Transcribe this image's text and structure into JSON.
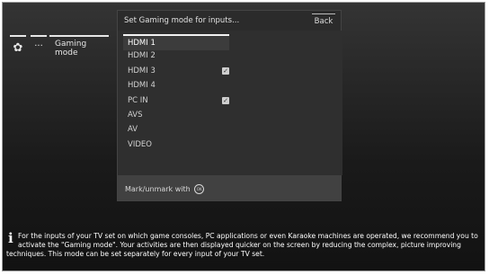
{
  "toolbar": {
    "gear_icon": "gear-icon",
    "more_label": "···",
    "gaming_label": "Gaming mode"
  },
  "panel": {
    "title": "Set Gaming mode for inputs...",
    "back_label": "Back",
    "items": [
      {
        "label": "HDMI 1",
        "checked": false,
        "selected": true
      },
      {
        "label": "HDMI 2",
        "checked": false,
        "selected": false
      },
      {
        "label": "HDMI 3",
        "checked": true,
        "selected": false
      },
      {
        "label": "HDMI 4",
        "checked": false,
        "selected": false
      },
      {
        "label": "PC IN",
        "checked": true,
        "selected": false
      },
      {
        "label": "AVS",
        "checked": false,
        "selected": false
      },
      {
        "label": "AV",
        "checked": false,
        "selected": false
      },
      {
        "label": "VIDEO",
        "checked": false,
        "selected": false
      }
    ],
    "footer_label": "Mark/unmark with",
    "ok_symbol": "OK"
  },
  "info": {
    "icon": "info-icon",
    "text": "For the inputs of your TV set on which game consoles, PC applications or even Karaoke machines are operated, we recommend you to activate the \"Gaming mode\". Your activities are then displayed quicker on the screen by reducing the complex, picture improving techniques. This mode can be set separately for every input of your TV set."
  }
}
